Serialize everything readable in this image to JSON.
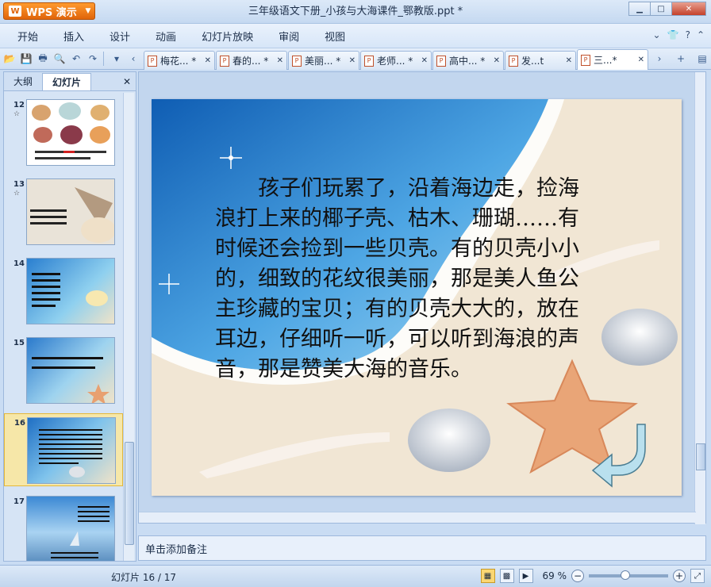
{
  "app": {
    "menu_button_label": "WPS 演示",
    "window_title": "三年级语文下册_小孩与大海课件_鄂教版.ppt *"
  },
  "menu": [
    "开始",
    "插入",
    "设计",
    "动画",
    "幻灯片放映",
    "审阅",
    "视图"
  ],
  "tabs": [
    {
      "label": "梅花... *"
    },
    {
      "label": "春的... *"
    },
    {
      "label": "美丽... *"
    },
    {
      "label": "老师... *"
    },
    {
      "label": "高中... *"
    },
    {
      "label": "发...t"
    },
    {
      "label": "三...*"
    }
  ],
  "left_panel": {
    "tab_outline": "大纲",
    "tab_slides": "幻灯片",
    "thumbnails": [
      {
        "number": "12"
      },
      {
        "number": "13"
      },
      {
        "number": "14"
      },
      {
        "number": "15"
      },
      {
        "number": "16"
      },
      {
        "number": "17"
      }
    ]
  },
  "slide": {
    "text": "孩子们玩累了，沿着海边走，捡海浪打上来的椰子壳、枯木、珊瑚……有时候还会捡到一些贝壳。有的贝壳小小的，细致的花纹很美丽，那是美人鱼公主珍藏的宝贝；有的贝壳大大的，放在耳边，仔细听一听，可以听到海浪的声音，那是赞美大海的音乐。"
  },
  "notes_placeholder": "单击添加备注",
  "status": {
    "slide_count": "幻灯片 16 / 17",
    "zoom": "69 %"
  }
}
